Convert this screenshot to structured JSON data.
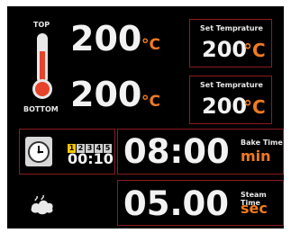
{
  "temperature": {
    "top_label": "TOP",
    "bottom_label": "BOTTOM",
    "top_value": "200",
    "bottom_value": "200",
    "unit": "°C",
    "set_label": "Set Temprature",
    "set_top_value": "200",
    "set_bottom_value": "200"
  },
  "timer": {
    "steps": [
      "1",
      "2",
      "3",
      "4",
      "5"
    ],
    "active_step": "1",
    "step_time": "00:10",
    "bake_time": "08:00",
    "bake_label": "Bake Time",
    "bake_unit": "min",
    "steam_time": "05.00",
    "steam_label": "Steam Time",
    "steam_unit": "sec"
  },
  "icons": {
    "thermometer": "thermometer-icon",
    "clock": "clock-icon",
    "steam": "steam-icon"
  },
  "colors": {
    "background": "#000000",
    "accent": "#f07a1e",
    "border": "#8a1c1c",
    "thermo": "#e5432b",
    "step_active": "#f5c400"
  }
}
